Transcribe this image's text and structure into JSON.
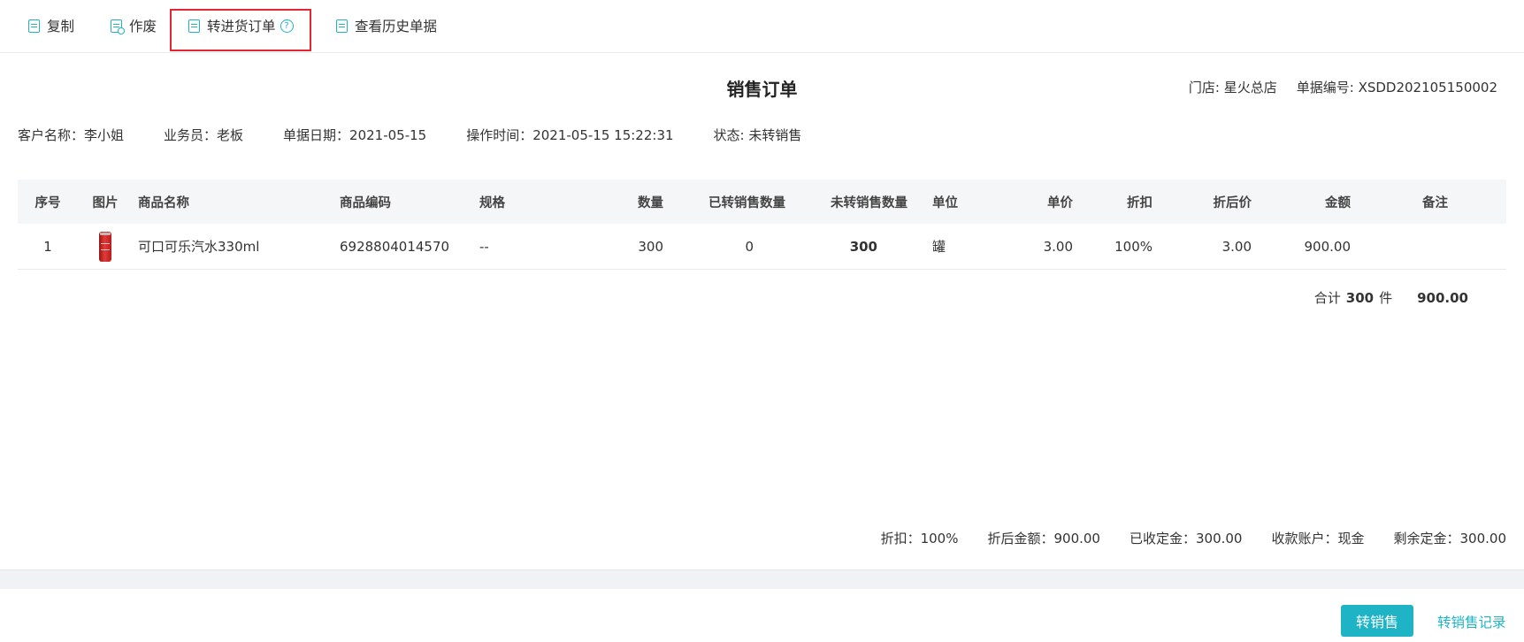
{
  "toolbar": {
    "copy_label": "复制",
    "void_label": "作废",
    "convert_purchase_label": "转进货订单",
    "history_label": "查看历史单据",
    "help_glyph": "?"
  },
  "document": {
    "title": "销售订单",
    "store": "门店: 星火总店",
    "doc_no": "单据编号: XSDD202105150002"
  },
  "info": {
    "customer": "客户名称：李小姐",
    "salesperson": "业务员：老板",
    "doc_date": "单据日期：2021-05-15",
    "op_time": "操作时间：2021-05-15 15:22:31",
    "status": "状态: 未转销售"
  },
  "table": {
    "headers": [
      "序号",
      "图片",
      "商品名称",
      "商品编码",
      "规格",
      "数量",
      "已转销售数量",
      "未转销售数量",
      "单位",
      "单价",
      "折扣",
      "折后价",
      "金额",
      "备注"
    ],
    "rows": [
      [
        "1",
        "",
        "可口可乐汽水330ml",
        "6928804014570",
        "--",
        "300",
        "0",
        "300",
        "罐",
        "3.00",
        "100%",
        "3.00",
        "900.00",
        ""
      ]
    ]
  },
  "totals": {
    "prefix": "合计",
    "qty": "300",
    "unit": "件",
    "amount": "900.00"
  },
  "summary": {
    "discount": "折扣：100%",
    "discounted_amount": "折后金额：900.00",
    "deposit_received": "已收定金：300.00",
    "account": "收款账户：现金",
    "deposit_remaining": "剩余定金：300.00"
  },
  "footer": {
    "convert_button": "转销售",
    "record_link": "转销售记录"
  },
  "colors": {
    "accent": "#1fb3c6",
    "highlight_border": "#e3262f"
  }
}
